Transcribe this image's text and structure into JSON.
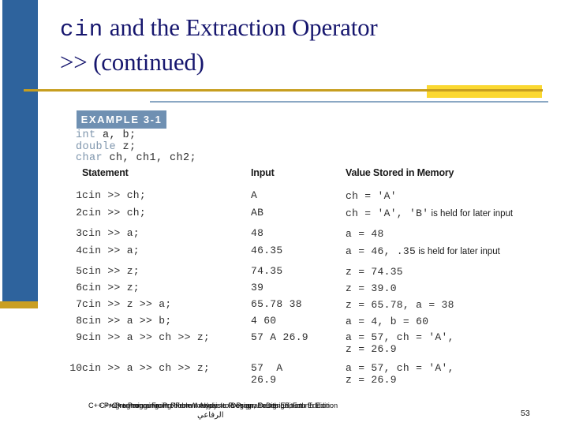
{
  "theme": {
    "rail_blue": "#2e639d",
    "rail_gold": "#ca9f22",
    "rule_gold": "#c79e1f",
    "accent_yellow": "#fbd831",
    "title_navy": "#16166e",
    "badge_blue": "#6f90b2",
    "code_keyword": "#7f96ad",
    "topline_blue": "#8ba8c4"
  },
  "slide": {
    "title_line1_mono": "cin",
    "title_line1_rest": " and the Extraction Operator",
    "title_line2": ">> (continued)"
  },
  "example": {
    "badge_label": "EXAMPLE 3-1",
    "declarations": [
      {
        "keyword": "int",
        "rest": " a, b;"
      },
      {
        "keyword": "double",
        "rest": " z;"
      },
      {
        "keyword": "char",
        "rest": " ch, ch1, ch2;"
      }
    ],
    "headers": {
      "num": "",
      "statement": "Statement",
      "input": "Input",
      "value": "Value Stored in Memory"
    },
    "rows": [
      {
        "num": "1",
        "statement": "cin >> ch;",
        "input": "A",
        "value_code": "ch = 'A'",
        "value_note": "",
        "value_code2": "",
        "input2": ""
      },
      {
        "num": "2",
        "statement": "cin >> ch;",
        "input": "AB",
        "value_code": "ch = 'A', 'B'",
        "value_note": " is held for later input",
        "value_code2": "",
        "input2": ""
      },
      {
        "num": "3",
        "statement": "cin >> a;",
        "input": "48",
        "value_code": "a = 48",
        "value_note": "",
        "value_code2": "",
        "input2": ""
      },
      {
        "num": "4",
        "statement": "cin >> a;",
        "input": "46.35",
        "value_code": "a = 46, .35",
        "value_note": " is held for later input",
        "value_code2": "",
        "input2": ""
      },
      {
        "num": "5",
        "statement": "cin >> z;",
        "input": "74.35",
        "value_code": "z = 74.35",
        "value_note": "",
        "value_code2": "",
        "input2": ""
      },
      {
        "num": "6",
        "statement": "cin >> z;",
        "input": "39",
        "value_code": "z = 39.0",
        "value_note": "",
        "value_code2": "",
        "input2": ""
      },
      {
        "num": "7",
        "statement": "cin >> z >> a;",
        "input": "65.78 38",
        "value_code": "z = 65.78, a = 38",
        "value_note": "",
        "value_code2": "",
        "input2": ""
      },
      {
        "num": "8",
        "statement": "cin >> a >> b;",
        "input": "4 60",
        "value_code": "a = 4, b = 60",
        "value_note": "",
        "value_code2": "",
        "input2": ""
      },
      {
        "num": "9",
        "statement": "cin >> a >> ch >> z;",
        "input": "57 A 26.9",
        "value_code": "a = 57, ch = 'A',",
        "value_note": "",
        "value_code2": "z = 26.9",
        "input2": ""
      },
      {
        "num": "10",
        "statement": "cin >> a >> ch >> z;",
        "input": "57  A",
        "value_code": "a = 57, ch = 'A',",
        "value_note": "",
        "value_code2": "z = 26.9",
        "input2": "26.9"
      }
    ]
  },
  "footer": {
    "source_layer1": "C++ Programming: From Problem Analysis to Program Design, Fourth Edition",
    "source_layer2": "C++ Programming: Problem Analysis to Program Design, Fourth Edition",
    "source_layer3": "C++ Programming: From Analysis to Design, Fourth Edition",
    "arabic": "الرفاعي",
    "page_number": "53"
  }
}
